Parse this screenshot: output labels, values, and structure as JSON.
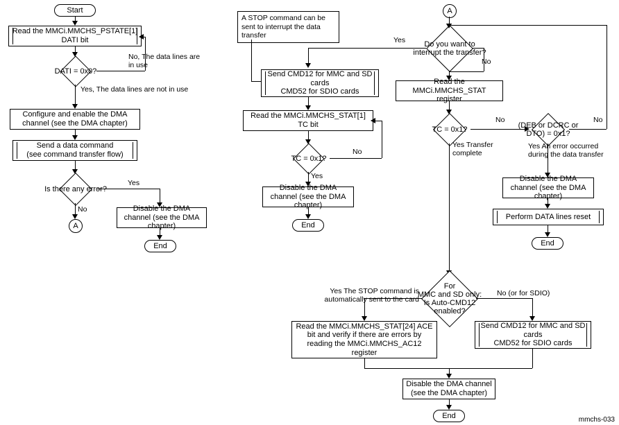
{
  "diagram_id": "mmchs-033",
  "col1": {
    "start": "Start",
    "read_pstate": "Read the MMCi.MMCHS_PSTATE[1] DATI bit",
    "dati_q": "DATI = 0x0?",
    "dati_no": "No, The data lines are in use",
    "dati_yes": "Yes, The data lines are not in use",
    "config_dma": "Configure and enable the DMA channel (see the DMA chapter)",
    "send_data_cmd": "Send a data command\n(see command transfer flow)",
    "err_q": "Is there any error?",
    "err_yes": "Yes",
    "err_no": "No",
    "disable_dma": "Disable the DMA channel (see the DMA chapter)",
    "end": "End",
    "conn_a": "A"
  },
  "col2": {
    "callout": "A STOP command can be sent to interrupt the data transfer",
    "send_cmd12": "Send CMD12 for MMC and SD cards\nCMD52 for SDIO cards",
    "read_stat_tc": "Read the MMCi.MMCHS_STAT[1] TC bit",
    "tc_q": "TC = 0x1?",
    "tc_yes": "Yes",
    "tc_no": "No",
    "disable_dma": "Disable the DMA channel (see the DMA chapter)",
    "end": "End"
  },
  "col3": {
    "conn_a": "A",
    "interrupt_q": "Do you want to interrupt the transfer?",
    "yes": "Yes",
    "no": "No",
    "read_stat": "Read the MMCi.MMCHS_STAT register",
    "tc_q": "TC = 0x1?",
    "tc_yes": "Yes\nTransfer complete",
    "tc_no": "No",
    "err_q": "(DEB or DCRC or DTO) = 0x1?",
    "err_yes": "Yes\nAn error occurred during the data transfer",
    "err_no": "No",
    "disable_dma_err": "Disable the DMA channel (see the DMA chapter)",
    "data_reset": "Perform DATA lines reset",
    "end_err": "End",
    "auto_q": "For\nMMC and SD only:\nIs Auto-CMD12\nenabled?",
    "auto_yes": "Yes\nThe STOP command is automatically sent to the card",
    "auto_no": "No\n(or for SDIO)",
    "read_ace": "Read the MMCi.MMCHS_STAT[24] ACE bit and verify if there are errors by reading the MMCi.MMCHS_AC12 register",
    "send_cmd12_b": "Send CMD12 for MMC and SD cards\nCMD52 for SDIO cards",
    "disable_dma_final": "Disable the DMA channel (see the DMA chapter)",
    "end_final": "End"
  },
  "chart_data": {
    "type": "flowchart",
    "figure_id": "mmchs-033",
    "subgraphs": [
      {
        "id": "left",
        "nodes": [
          {
            "id": "start",
            "type": "terminator",
            "text": "Start"
          },
          {
            "id": "read_pstate",
            "type": "predefined-process",
            "text": "Read the MMCi.MMCHS_PSTATE[1] DATI bit"
          },
          {
            "id": "dati_q",
            "type": "decision",
            "text": "DATI = 0x0?"
          },
          {
            "id": "config_dma",
            "type": "process",
            "text": "Configure and enable the DMA channel (see the DMA chapter)"
          },
          {
            "id": "send_data_cmd",
            "type": "predefined-process",
            "text": "Send a data command (see command transfer flow)"
          },
          {
            "id": "err_q",
            "type": "decision",
            "text": "Is there any error?"
          },
          {
            "id": "disable_dma1",
            "type": "process",
            "text": "Disable the DMA channel (see the DMA chapter)"
          },
          {
            "id": "conn_a_out",
            "type": "connector",
            "text": "A"
          },
          {
            "id": "end1",
            "type": "terminator",
            "text": "End"
          }
        ],
        "edges": [
          {
            "from": "start",
            "to": "read_pstate"
          },
          {
            "from": "read_pstate",
            "to": "dati_q"
          },
          {
            "from": "dati_q",
            "to": "read_pstate",
            "label": "No, The data lines are in use"
          },
          {
            "from": "dati_q",
            "to": "config_dma",
            "label": "Yes, The data lines are not in use"
          },
          {
            "from": "config_dma",
            "to": "send_data_cmd"
          },
          {
            "from": "send_data_cmd",
            "to": "err_q"
          },
          {
            "from": "err_q",
            "to": "disable_dma1",
            "label": "Yes"
          },
          {
            "from": "err_q",
            "to": "conn_a_out",
            "label": "No"
          },
          {
            "from": "disable_dma1",
            "to": "end1"
          }
        ]
      },
      {
        "id": "middle",
        "annotations": [
          {
            "text": "A STOP command can be sent to interrupt the data transfer",
            "attached_to": "send_cmd12_a"
          }
        ],
        "nodes": [
          {
            "id": "send_cmd12_a",
            "type": "predefined-process",
            "text": "Send CMD12 for MMC and SD cards CMD52 for SDIO cards"
          },
          {
            "id": "read_stat_tc",
            "type": "process",
            "text": "Read the MMCi.MMCHS_STAT[1] TC bit"
          },
          {
            "id": "tc_q_a",
            "type": "decision",
            "text": "TC = 0x1?"
          },
          {
            "id": "disable_dma2",
            "type": "process",
            "text": "Disable the DMA channel (see the DMA chapter)"
          },
          {
            "id": "end2",
            "type": "terminator",
            "text": "End"
          }
        ],
        "edges": [
          {
            "from": "send_cmd12_a",
            "to": "read_stat_tc"
          },
          {
            "from": "read_stat_tc",
            "to": "tc_q_a"
          },
          {
            "from": "tc_q_a",
            "to": "read_stat_tc",
            "label": "No"
          },
          {
            "from": "tc_q_a",
            "to": "disable_dma2",
            "label": "Yes"
          },
          {
            "from": "disable_dma2",
            "to": "end2"
          }
        ]
      },
      {
        "id": "right",
        "nodes": [
          {
            "id": "conn_a_in",
            "type": "connector",
            "text": "A"
          },
          {
            "id": "interrupt_q",
            "type": "decision",
            "text": "Do you want to interrupt the transfer?"
          },
          {
            "id": "read_stat",
            "type": "process",
            "text": "Read the MMCi.MMCHS_STAT register"
          },
          {
            "id": "tc_q_b",
            "type": "decision",
            "text": "TC = 0x1?"
          },
          {
            "id": "deb_q",
            "type": "decision",
            "text": "(DEB or DCRC or DTO) = 0x1?"
          },
          {
            "id": "disable_dma_err",
            "type": "process",
            "text": "Disable the DMA channel (see the DMA chapter)"
          },
          {
            "id": "data_reset",
            "type": "predefined-process",
            "text": "Perform DATA lines reset"
          },
          {
            "id": "end_err",
            "type": "terminator",
            "text": "End"
          },
          {
            "id": "auto_q",
            "type": "decision",
            "text": "For MMC and SD only: Is Auto-CMD12 enabled?"
          },
          {
            "id": "read_ace",
            "type": "process",
            "text": "Read the MMCi.MMCHS_STAT[24] ACE bit and verify if there are errors by reading the MMCi.MMCHS_AC12 register"
          },
          {
            "id": "send_cmd12_b",
            "type": "predefined-process",
            "text": "Send CMD12 for MMC and SD cards CMD52 for SDIO cards"
          },
          {
            "id": "disable_dma3",
            "type": "process",
            "text": "Disable the DMA channel (see the DMA chapter)"
          },
          {
            "id": "end3",
            "type": "terminator",
            "text": "End"
          }
        ],
        "edges": [
          {
            "from": "conn_a_in",
            "to": "interrupt_q"
          },
          {
            "from": "interrupt_q",
            "to": "send_cmd12_a",
            "label": "Yes"
          },
          {
            "from": "interrupt_q",
            "to": "read_stat",
            "label": "No"
          },
          {
            "from": "read_stat",
            "to": "tc_q_b"
          },
          {
            "from": "tc_q_b",
            "to": "deb_q",
            "label": "No"
          },
          {
            "from": "tc_q_b",
            "to": "auto_q",
            "label": "Yes, Transfer complete"
          },
          {
            "from": "deb_q",
            "to": "interrupt_q",
            "label": "No"
          },
          {
            "from": "deb_q",
            "to": "disable_dma_err",
            "label": "Yes, An error occurred during the data transfer"
          },
          {
            "from": "disable_dma_err",
            "to": "data_reset"
          },
          {
            "from": "data_reset",
            "to": "end_err"
          },
          {
            "from": "auto_q",
            "to": "read_ace",
            "label": "Yes, The STOP command is automatically sent to the card"
          },
          {
            "from": "auto_q",
            "to": "send_cmd12_b",
            "label": "No (or for SDIO)"
          },
          {
            "from": "read_ace",
            "to": "disable_dma3"
          },
          {
            "from": "send_cmd12_b",
            "to": "disable_dma3"
          },
          {
            "from": "disable_dma3",
            "to": "end3"
          }
        ]
      }
    ]
  }
}
